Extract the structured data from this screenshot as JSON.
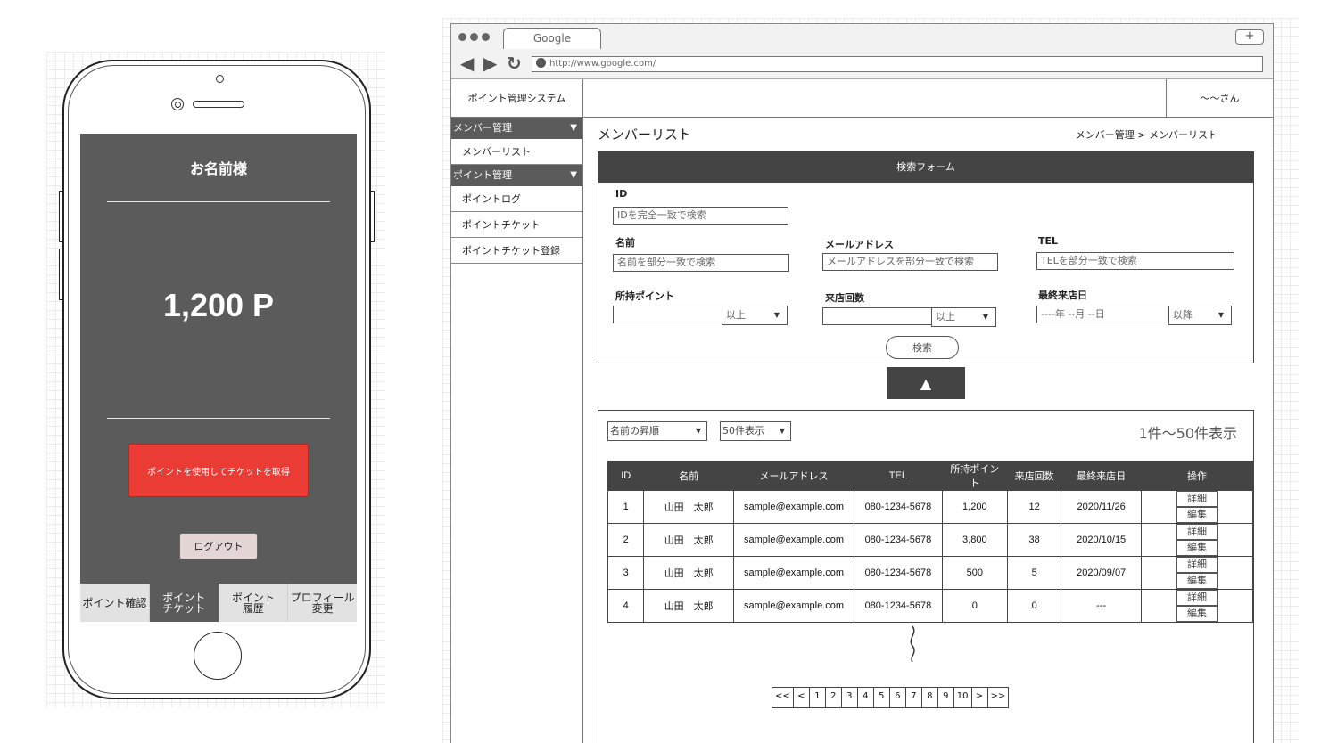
{
  "phone": {
    "user_name": "お名前様",
    "points": "1,200 P",
    "use_button": "ポイントを使用してチケットを取得",
    "logout_button": "ログアウト",
    "tabs": [
      {
        "label": "ポイント確認",
        "active": false
      },
      {
        "label": "ポイント\nチケット",
        "active": true
      },
      {
        "label": "ポイント\n履歴",
        "active": false
      },
      {
        "label": "プロフィール\n変更",
        "active": false
      }
    ]
  },
  "browser": {
    "tab_title": "Google",
    "url": "http://www.google.com/",
    "new_tab": "+"
  },
  "header": {
    "brand": "ポイント管理システム",
    "user": "〜〜さん"
  },
  "sidebar": {
    "groups": [
      {
        "label": "メンバー管理",
        "arrow": "▼",
        "items": [
          "メンバーリスト"
        ]
      },
      {
        "label": "ポイント管理",
        "arrow": "▼",
        "items": [
          "ポイントログ",
          "ポイントチケット",
          "ポイントチケット登録"
        ]
      }
    ]
  },
  "main": {
    "title": "メンバーリスト",
    "breadcrumb": "メンバー管理 > メンバーリスト"
  },
  "search_form": {
    "heading": "検索フォーム",
    "id_label": "ID",
    "id_placeholder": "IDを完全一致で検索",
    "name_label": "名前",
    "name_placeholder": "名前を部分一致で検索",
    "email_label": "メールアドレス",
    "email_placeholder": "メールアドレスを部分一致で検索",
    "tel_label": "TEL",
    "tel_placeholder": "TELを部分一致で検索",
    "points_label": "所持ポイント",
    "points_cond": "以上",
    "visits_label": "来店回数",
    "visits_cond": "以上",
    "last_visit_label": "最終来店日",
    "last_visit_placeholder": "----年 --月 --日",
    "last_visit_cond": "以降",
    "search_button": "検索",
    "collapse_icon": "▲"
  },
  "list": {
    "sort_select": "名前の昇順",
    "per_page_select": "50件表示",
    "count_text": "1件〜50件表示",
    "columns": [
      "ID",
      "名前",
      "メールアドレス",
      "TEL",
      "所持ポイント",
      "来店回数",
      "最終来店日",
      "操作"
    ],
    "detail_label": "詳細",
    "edit_label": "編集",
    "rows": [
      {
        "id": "1",
        "name": "山田　太郎",
        "email": "sample@example.com",
        "tel": "080-1234-5678",
        "points": "1,200",
        "visits": "12",
        "last_visit": "2020/11/26"
      },
      {
        "id": "2",
        "name": "山田　太郎",
        "email": "sample@example.com",
        "tel": "080-1234-5678",
        "points": "3,800",
        "visits": "38",
        "last_visit": "2020/10/15"
      },
      {
        "id": "3",
        "name": "山田　太郎",
        "email": "sample@example.com",
        "tel": "080-1234-5678",
        "points": "500",
        "visits": "5",
        "last_visit": "2020/09/07"
      },
      {
        "id": "4",
        "name": "山田　太郎",
        "email": "sample@example.com",
        "tel": "080-1234-5678",
        "points": "0",
        "visits": "0",
        "last_visit": "---"
      }
    ],
    "pagination": [
      "<<",
      "<",
      "1",
      "2",
      "3",
      "4",
      "5",
      "6",
      "7",
      "8",
      "9",
      "10",
      ">",
      ">>"
    ]
  },
  "colors": {
    "dark": "#5b5b5b",
    "table_header": "#444444",
    "accent_red": "#ea3b35",
    "logout_bg": "#e4d6d5"
  }
}
